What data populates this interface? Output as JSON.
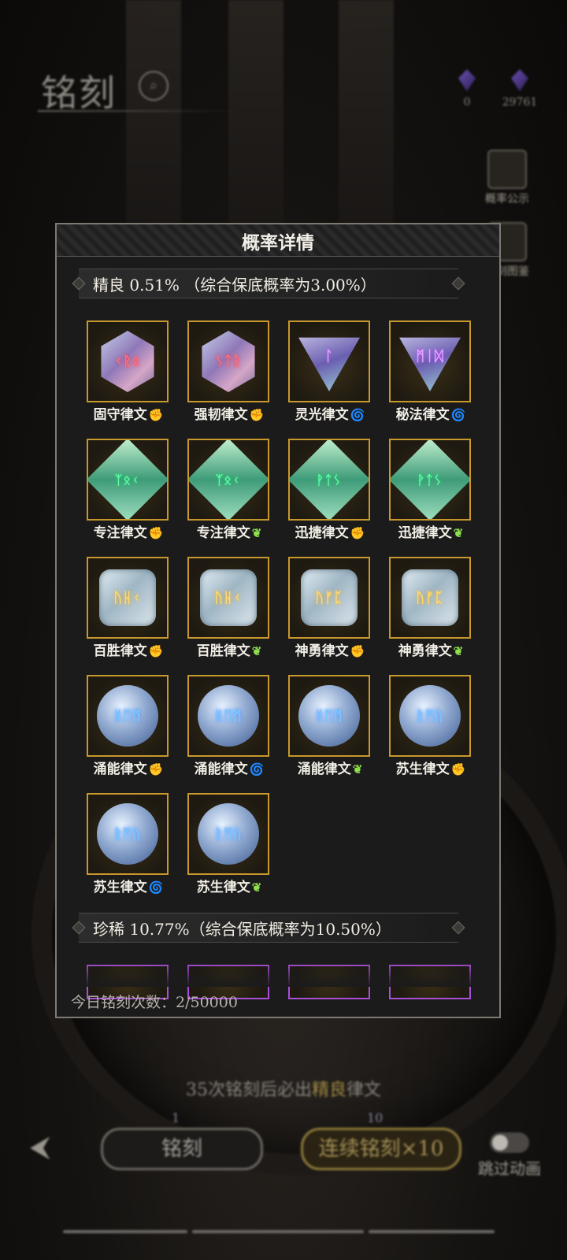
{
  "background": {
    "page_title": "铭刻",
    "currencies": [
      {
        "value": "0",
        "icon": "purple-gem-icon"
      },
      {
        "value": "29761",
        "icon": "blue-gem-icon"
      }
    ],
    "side_buttons": [
      {
        "label": "概率公示",
        "icon": "probability-icon"
      },
      {
        "label": "铭刻图鉴",
        "icon": "codex-icon"
      }
    ],
    "hint": {
      "prefix": "35次铭刻后必出",
      "highlight": "精良",
      "suffix": "律文"
    },
    "single_counter": "1",
    "multi_counter": "10",
    "buttons": {
      "single": "铭刻",
      "multi": "连续铭刻×10"
    },
    "toggle_label": "跳过动画",
    "colors": {
      "gold": "#c8982c",
      "purple": "#a94fd6"
    }
  },
  "modal": {
    "title": "概率详情",
    "sections": [
      {
        "label": "精良  0.51%  （综合保底概率为3.00%）"
      },
      {
        "label": "珍稀  10.77%（综合保底概率为10.50%）"
      }
    ],
    "fine_runes": [
      {
        "name": "固守律文",
        "glyphs": "ᚲᚱᛟ",
        "gem": "hex",
        "tag": "✊",
        "tag_type": "fist"
      },
      {
        "name": "强韧律文",
        "glyphs": "ᛊᛏᚱ",
        "gem": "hex",
        "tag": "✊",
        "tag_type": "fist"
      },
      {
        "name": "灵光律文",
        "glyphs": "ᛚ",
        "gem": "tri",
        "tag": "🌀",
        "tag_type": "swirl"
      },
      {
        "name": "秘法律文",
        "glyphs": "ᛗᛁᛞ",
        "gem": "tri",
        "tag": "🌀",
        "tag_type": "swirl"
      },
      {
        "name": "专注律文",
        "glyphs": "ᛉᛟᚲ",
        "gem": "dia",
        "tag": "✊",
        "tag_type": "fist"
      },
      {
        "name": "专注律文",
        "glyphs": "ᛉᛟᚲ",
        "gem": "dia",
        "tag": "❦",
        "tag_type": "feather"
      },
      {
        "name": "迅捷律文",
        "glyphs": "ᚹᛏᛊ",
        "gem": "dia",
        "tag": "✊",
        "tag_type": "fist"
      },
      {
        "name": "迅捷律文",
        "glyphs": "ᚹᛏᛊ",
        "gem": "dia",
        "tag": "❦",
        "tag_type": "feather"
      },
      {
        "name": "百胜律文",
        "glyphs": "ᚢᚺᚲ",
        "gem": "sq",
        "tag": "✊",
        "tag_type": "fist"
      },
      {
        "name": "百胜律文",
        "glyphs": "ᚢᚺᚲ",
        "gem": "sq",
        "tag": "❦",
        "tag_type": "feather"
      },
      {
        "name": "神勇律文",
        "glyphs": "ᚢᚠᛈ",
        "gem": "sq",
        "tag": "✊",
        "tag_type": "fist"
      },
      {
        "name": "神勇律文",
        "glyphs": "ᚢᚠᛈ",
        "gem": "sq",
        "tag": "❦",
        "tag_type": "feather"
      },
      {
        "name": "涌能律文",
        "glyphs": "ᚻᛖᛗ",
        "gem": "round",
        "tag": "✊",
        "tag_type": "fist"
      },
      {
        "name": "涌能律文",
        "glyphs": "ᚻᛖᛗ",
        "gem": "round",
        "tag": "🌀",
        "tag_type": "swirl"
      },
      {
        "name": "涌能律文",
        "glyphs": "ᚻᛖᛗ",
        "gem": "round",
        "tag": "❦",
        "tag_type": "feather"
      },
      {
        "name": "苏生律文",
        "glyphs": "ᚱᛗᚢ",
        "gem": "round",
        "tag": "✊",
        "tag_type": "fist"
      },
      {
        "name": "苏生律文",
        "glyphs": "ᚱᛗᚢ",
        "gem": "round",
        "tag": "🌀",
        "tag_type": "swirl"
      },
      {
        "name": "苏生律文",
        "glyphs": "ᚱᛗᚢ",
        "gem": "round",
        "tag": "❦",
        "tag_type": "feather"
      }
    ],
    "rare_runes_visible": 4,
    "footer": "今日铭刻次数：2/50000"
  }
}
